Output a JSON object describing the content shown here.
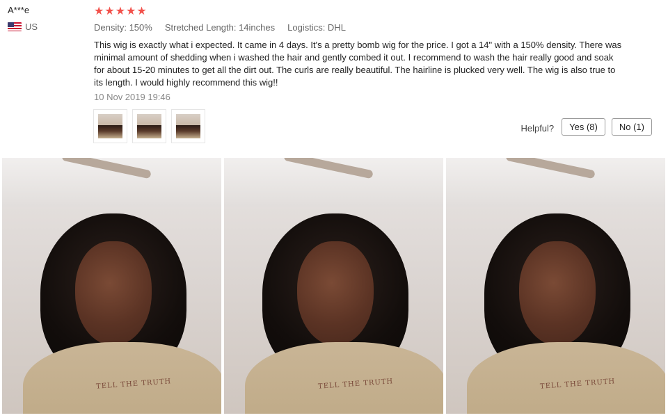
{
  "reviewer": {
    "name": "A***e",
    "country": "US"
  },
  "review": {
    "rating": 5,
    "stars": [
      "★",
      "★",
      "★",
      "★",
      "★"
    ],
    "attributes": [
      "Density: 150%",
      "Stretched Length: 14inches",
      "Logistics: DHL"
    ],
    "text": "This wig is exactly what i expected. It came in 4 days. It's a pretty bomb wig for the price. I got a 14\" with a 150% density. There was minimal amount of shedding when i washed the hair and gently combed it out. I recommend to wash the hair really good and soak for about 15-20 minutes to get all the dirt out. The curls are really beautiful. The hairline is plucked very well. The wig is also true to its length. I would highly recommend this wig!!",
    "date": "10  Nov 2019 19:46"
  },
  "helpful": {
    "label": "Helpful?",
    "yes_label": "Yes (8)",
    "no_label": "No (1)"
  },
  "photos": {
    "hoodie_print": "TELL THE TRUTH"
  },
  "colors": {
    "star": "#f2514b",
    "text": "#222222",
    "muted": "#666666"
  }
}
